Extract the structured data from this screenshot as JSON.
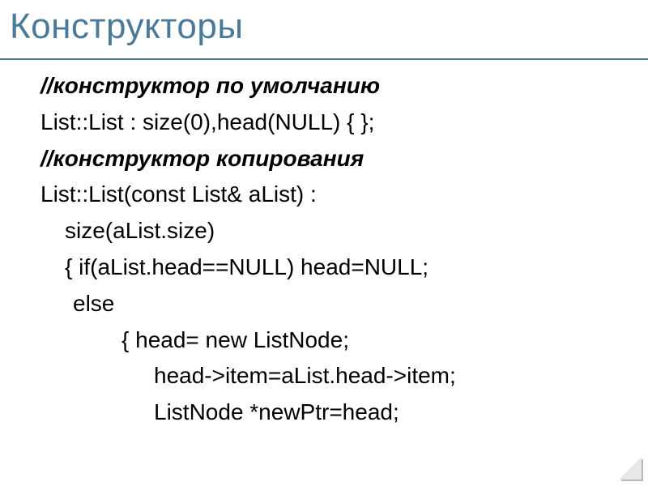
{
  "title": "Конструкторы",
  "lines": {
    "l1": "//конструктор по умолчанию",
    "l2": "List::List : size(0),head(NULL) { };",
    "l3": "//конструктор копирования",
    "l4": "List::List(const List& aList) :",
    "l5": "size(aList.size)",
    "l6": "{ if(aList.head==NULL) head=NULL;",
    "l7": "else",
    "l8": "{ head= new ListNode;",
    "l9": "head->item=aList.head->item;",
    "l10": "ListNode *newPtr=head;"
  }
}
